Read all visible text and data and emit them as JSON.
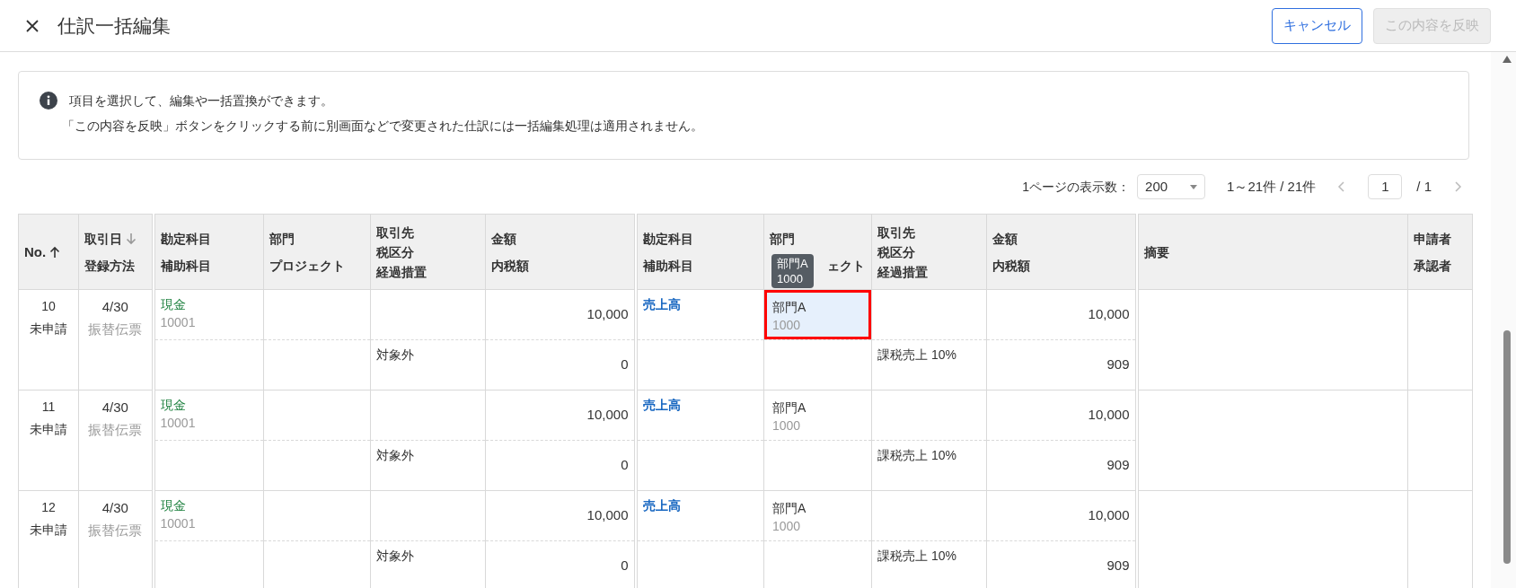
{
  "header": {
    "title": "仕訳一括編集",
    "buttons": [
      {
        "label": "キャンセル",
        "disabled": false
      },
      {
        "label": "この内容を反映",
        "disabled": true
      }
    ]
  },
  "info": {
    "lines": [
      "項目を選択して、編集や一括置換ができます。",
      "「この内容を反映」ボタンをクリックする前に別画面などで変更された仕訳には一括編集処理は適用されません。"
    ]
  },
  "pagination": {
    "per_page_label": "1ページの表示数：",
    "per_page": "200",
    "range": "1～21件 / 21件",
    "page": "1",
    "total_pages": "/ 1",
    "prev_disabled": true,
    "next_disabled": true
  },
  "table": {
    "column_groups": [
      [
        {
          "lines": [
            "No."
          ],
          "ascending": true
        },
        {
          "lines": [
            "取引日",
            "登録方法"
          ],
          "ascending": false
        }
      ],
      [
        {
          "lines": [
            "勘定科目",
            "補助科目"
          ]
        },
        {
          "lines": [
            "部門",
            "プロジェクト"
          ]
        },
        {
          "lines": [
            "取引先",
            "税区分",
            "経過措置"
          ]
        },
        {
          "lines": [
            "金額",
            "内税額"
          ]
        }
      ],
      [
        {
          "lines": [
            "勘定科目",
            "補助科目"
          ]
        },
        {
          "lines": [
            "部門",
            "ェクト"
          ],
          "tooltip": [
            "部門A",
            "1000"
          ]
        },
        {
          "lines": [
            "取引先",
            "税区分",
            "経過措置"
          ]
        },
        {
          "lines": [
            "金額",
            "内税額"
          ]
        }
      ],
      [
        {
          "lines": [
            "摘要"
          ]
        },
        {
          "lines": [
            "申請者",
            "承認者"
          ]
        }
      ]
    ],
    "rows": [
      {
        "no": "10",
        "status": "未申請",
        "date": "4/30",
        "method": "振替伝票",
        "debit": {
          "account": "現金",
          "sub": "10001",
          "tax": "対象外",
          "amount": "10,000",
          "tax_amount": "0"
        },
        "credit": {
          "account": "売上高",
          "dept": "部門A",
          "dept_code": "1000",
          "tax": "課税売上 10%",
          "amount": "10,000",
          "tax_amount": "909",
          "selected": true
        }
      },
      {
        "no": "11",
        "status": "未申請",
        "date": "4/30",
        "method": "振替伝票",
        "debit": {
          "account": "現金",
          "sub": "10001",
          "tax": "対象外",
          "amount": "10,000",
          "tax_amount": "0"
        },
        "credit": {
          "account": "売上高",
          "dept": "部門A",
          "dept_code": "1000",
          "tax": "課税売上 10%",
          "amount": "10,000",
          "tax_amount": "909",
          "selected": false
        }
      },
      {
        "no": "12",
        "status": "未申請",
        "date": "4/30",
        "method": "振替伝票",
        "debit": {
          "account": "現金",
          "sub": "10001",
          "tax": "対象外",
          "amount": "10,000",
          "tax_amount": "0"
        },
        "credit": {
          "account": "売上高",
          "dept": "部門A",
          "dept_code": "1000",
          "tax": "課税売上 10%",
          "amount": "10,000",
          "tax_amount": "909",
          "selected": false
        }
      }
    ]
  }
}
